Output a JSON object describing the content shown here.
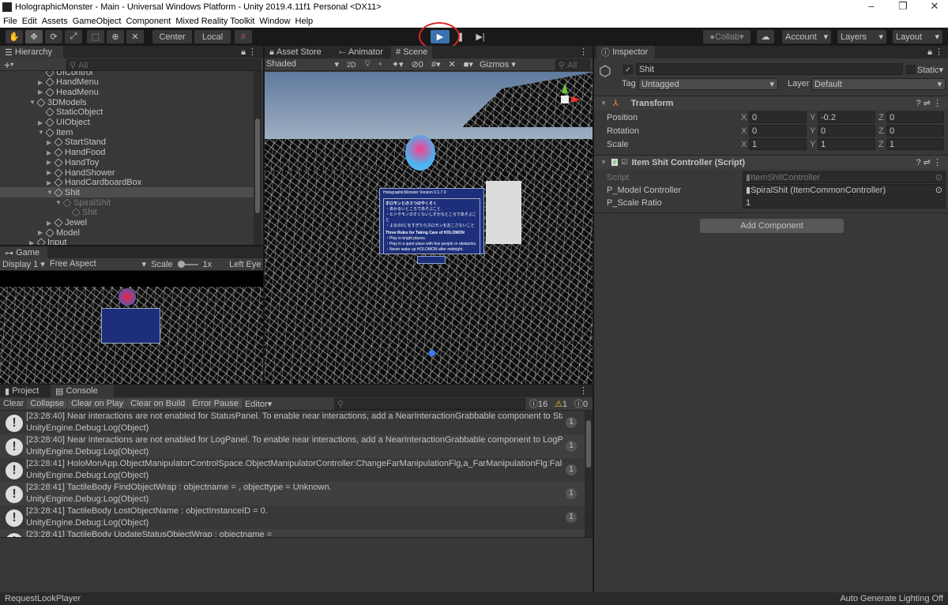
{
  "window": {
    "title": "HolographicMonster - Main - Universal Windows Platform - Unity 2019.4.11f1 Personal <DX11>",
    "minimize": "–",
    "maximize": "❐",
    "close": "✕"
  },
  "menu": [
    "File",
    "Edit",
    "Assets",
    "GameObject",
    "Component",
    "Mixed Reality Toolkit",
    "Window",
    "Help"
  ],
  "toolbar": {
    "tools": [
      "hand-tool",
      "move-tool",
      "rotate-tool",
      "scale-tool",
      "rect-tool",
      "transform-tool",
      "custom-tool"
    ],
    "pivot": "Center",
    "space": "Local",
    "collab": "Collab",
    "account": "Account",
    "layers": "Layers",
    "layout": "Layout",
    "play_state": "playing",
    "accent": "#3a72b0",
    "annotation_color": "#d9262b"
  },
  "hierarchy": {
    "tab": "Hierarchy",
    "search_placeholder": "All",
    "add": "+",
    "items": [
      {
        "label": "UIControl",
        "depth": 2,
        "arrow": ""
      },
      {
        "label": "HandMenu",
        "depth": 2,
        "arrow": "▶"
      },
      {
        "label": "HeadMenu",
        "depth": 2,
        "arrow": "▶"
      },
      {
        "label": "3DModels",
        "depth": 1,
        "arrow": "▼"
      },
      {
        "label": "StaticObject",
        "depth": 2,
        "arrow": ""
      },
      {
        "label": "UIObject",
        "depth": 2,
        "arrow": "▶"
      },
      {
        "label": "Item",
        "depth": 2,
        "arrow": "▼"
      },
      {
        "label": "StartStand",
        "depth": 3,
        "arrow": "▶"
      },
      {
        "label": "HandFood",
        "depth": 3,
        "arrow": "▶"
      },
      {
        "label": "HandToy",
        "depth": 3,
        "arrow": "▶"
      },
      {
        "label": "HandShower",
        "depth": 3,
        "arrow": "▶"
      },
      {
        "label": "HandCardboardBox",
        "depth": 3,
        "arrow": "▶"
      },
      {
        "label": "Shit",
        "depth": 3,
        "arrow": "▼",
        "selected": true
      },
      {
        "label": "SpiralShit",
        "depth": 4,
        "arrow": "▼",
        "dim": true
      },
      {
        "label": "Shit",
        "depth": 5,
        "arrow": "",
        "dim": true
      },
      {
        "label": "Jewel",
        "depth": 3,
        "arrow": "▶"
      },
      {
        "label": "Model",
        "depth": 2,
        "arrow": "▶"
      },
      {
        "label": "Input",
        "depth": 1,
        "arrow": "▶"
      }
    ]
  },
  "game": {
    "tab": "Game",
    "display": "Display 1",
    "aspect": "Free Aspect",
    "scale_label": "Scale",
    "scale_value": "1x",
    "eye": "Left Eye"
  },
  "scene": {
    "tabs": [
      "Asset Store",
      "Animator",
      "Scene"
    ],
    "shading": "Shaded",
    "mode_2d": "2D",
    "hidden_count": "0",
    "gizmos": "Gizmos",
    "search_placeholder": "All",
    "panel": {
      "header": "HolographicMonster   Version 0.1.7.0",
      "jp_title": "ホロモンとの３つのやくそく",
      "jp_rules": [
        "・あかるいところであそぶこと",
        "・ヒトやモノのすくないしずかなところであそぶこと",
        "・よるの0じをすぎたらホロモンをおこさないこと"
      ],
      "en_title": "Three Rules for Taking Care of HOLOMON",
      "en_rules": [
        "・Play in bright places.",
        "・Play in a quiet place with few people or obstacles.",
        "・Never wake up HOLOMON after midnight."
      ]
    }
  },
  "inspector": {
    "tab": "Inspector",
    "object_name": "Shit",
    "static": "Static",
    "tag_label": "Tag",
    "tag": "Untagged",
    "layer_label": "Layer",
    "layer": "Default",
    "transform": {
      "title": "Transform",
      "rows": [
        {
          "label": "Position",
          "x": "0",
          "y": "-0.2",
          "z": "0"
        },
        {
          "label": "Rotation",
          "x": "0",
          "y": "0",
          "z": "0"
        },
        {
          "label": "Scale",
          "x": "1",
          "y": "1",
          "z": "1"
        }
      ]
    },
    "script": {
      "title": "Item Shit Controller (Script)",
      "script_label": "Script",
      "script_value": "ItemShitController",
      "model_label": "P_Model Controller",
      "model_value": "SpiralShit (ItemCommonController)",
      "ratio_label": "P_Scale Ratio",
      "ratio_value": "1"
    },
    "add_component": "Add Component"
  },
  "console": {
    "tabs": [
      "Project",
      "Console"
    ],
    "buttons": [
      "Clear",
      "Collapse",
      "Clear on Play",
      "Clear on Build",
      "Error Pause",
      "Editor"
    ],
    "counts": {
      "info": "16",
      "warn": "1",
      "error": "0"
    },
    "entries": [
      {
        "line1": "[23:28:40] Near interactions are not enabled for StatusPanel. To enable near interactions, add a NearInteractionGrabbable component to StatusPanel or t",
        "line2": "UnityEngine.Debug:Log(Object)",
        "count": "1"
      },
      {
        "line1": "[23:28:40] Near interactions are not enabled for LogPanel. To enable near interactions, add a NearInteractionGrabbable component to LogPanel or to a c",
        "line2": "UnityEngine.Debug:Log(Object)",
        "count": "1"
      },
      {
        "line1": "[23:28:41] HoloMonApp.ObjectManipulatorControlSpace.ObjectManipulatorController:ChangeFarManipulationFlg,a_FarManipulationFlg:False",
        "line2": "UnityEngine.Debug:Log(Object)",
        "count": "1"
      },
      {
        "line1": "[23:28:41] TactileBody FindObjectWrap : objectname = , objecttype = Unknown.",
        "line2": "UnityEngine.Debug:Log(Object)",
        "count": "1"
      },
      {
        "line1": "[23:28:41] TactileBody LostObjectName : objectInstanceID = 0.",
        "line2": "UnityEngine.Debug:Log(Object)",
        "count": "1"
      },
      {
        "line1": "[23:28:41] TactileBody UpdateStatusObjectWrap : objectname =",
        "line2": "",
        "count": ""
      }
    ]
  },
  "status": {
    "left": "RequestLookPlayer",
    "right": "Auto Generate Lighting Off"
  }
}
